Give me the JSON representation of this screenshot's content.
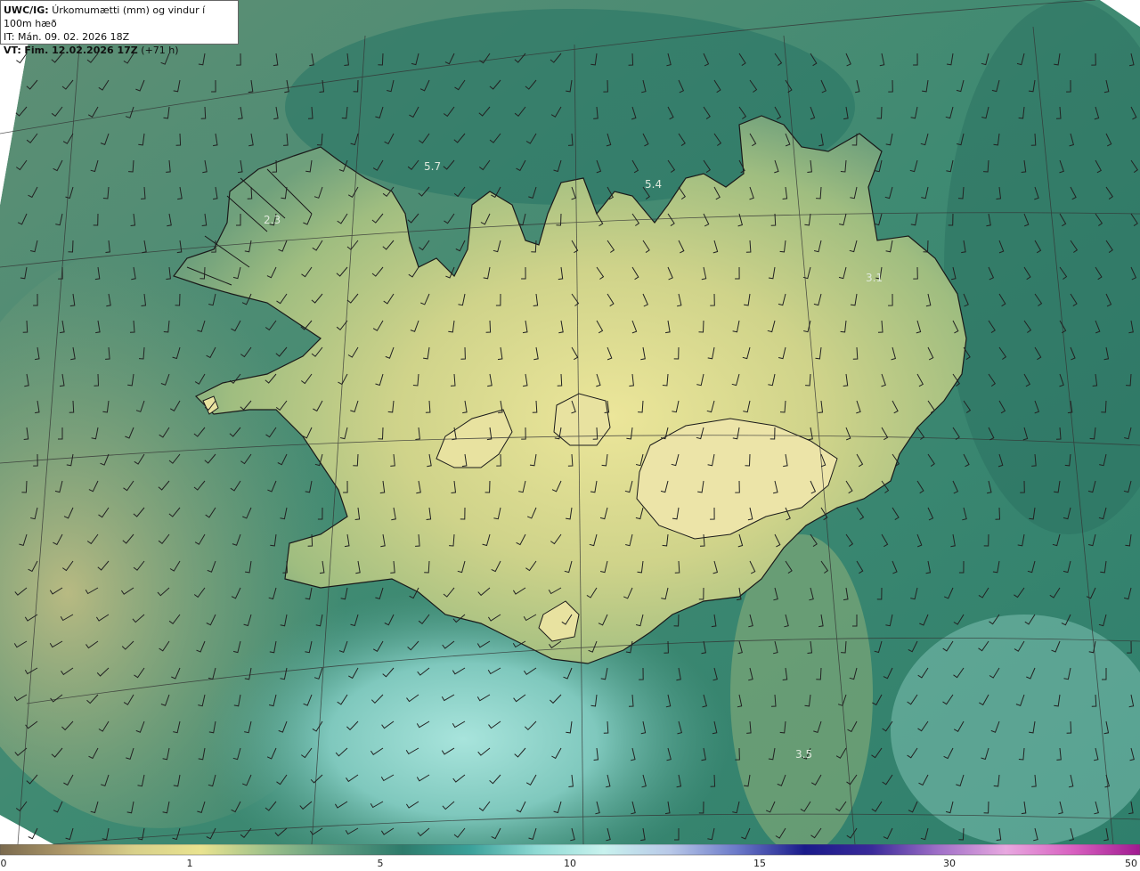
{
  "header": {
    "model": "UWC/IG:",
    "title": "Úrkomumætti (mm) og vindur í 100m hæð",
    "init_time": "IT: Mán. 09. 02. 2026 18Z",
    "valid_prefix": "VT:",
    "valid_time": "Fim. 12.02.2026 17Z",
    "lead": "(+71 h)"
  },
  "map_labels": [
    "5.7",
    "5.4",
    "2.3",
    "3.1",
    "3.5"
  ],
  "colorbar": {
    "ticks": [
      "0",
      "1",
      "5",
      "10",
      "15",
      "30",
      "50"
    ],
    "colors": [
      "#7a6a4e",
      "#b09a6a",
      "#d8d08a",
      "#e9e38f",
      "#9cc08a",
      "#5b9a7f",
      "#2e7b6b",
      "#3aa099",
      "#8fdad4",
      "#c8f2ee",
      "#b8c8e8",
      "#6a78c8",
      "#1a1a8a",
      "#3a2a9a",
      "#a070c8",
      "#e8a8e0",
      "#d860c0",
      "#a01a90"
    ]
  },
  "colors": {
    "ocean_deep": "#1f6f63",
    "ocean_mid": "#3b8a72",
    "land_low": "#9fb87a",
    "land_high": "#e6e29a",
    "coast": "#1a1a1a",
    "barb": "#222222",
    "grid": "#333333"
  }
}
